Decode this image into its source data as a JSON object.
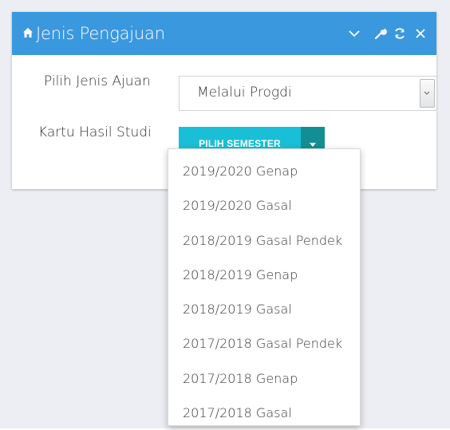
{
  "window": {
    "title": "Jenis Pengajuan",
    "header_color": "#3a98df"
  },
  "form": {
    "jenis_label": "Pilih Jenis Ajuan",
    "jenis_value": "Melalui Progdi",
    "khs_label": "Kartu Hasil Studi",
    "semester_button": "PILIH SEMESTER",
    "button_color": "#19bfd6"
  },
  "semester_options": [
    "2019/2020 Genap",
    "2019/2020 Gasal",
    "2018/2019 Gasal Pendek",
    "2018/2019 Genap",
    "2018/2019 Gasal",
    "2017/2018 Gasal Pendek",
    "2017/2018 Genap",
    "2017/2018 Gasal"
  ],
  "icons": {
    "title": "home-icon",
    "tools": [
      "chevron-down-icon",
      "wrench-icon",
      "refresh-icon",
      "close-icon"
    ]
  }
}
